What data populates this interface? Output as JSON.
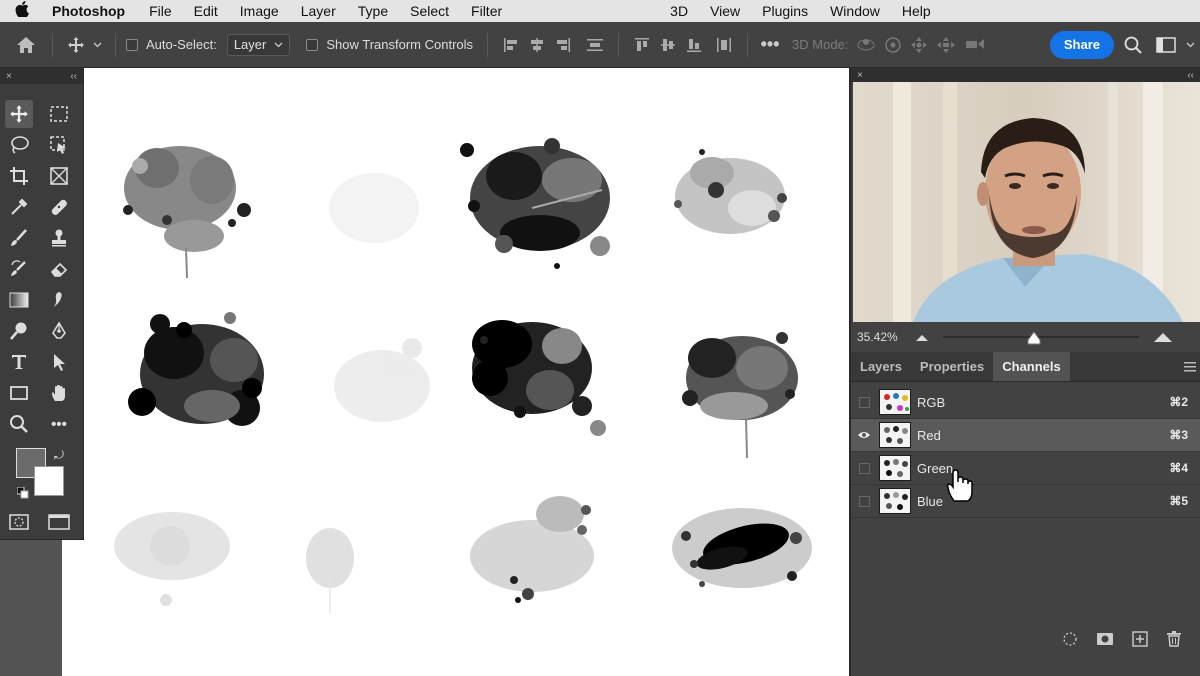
{
  "menubar": {
    "app_name": "Photoshop",
    "items_left": [
      "File",
      "Edit",
      "Image",
      "Layer",
      "Type",
      "Select",
      "Filter"
    ],
    "items_right": [
      "3D",
      "View",
      "Plugins",
      "Window",
      "Help"
    ]
  },
  "options": {
    "auto_select_label": "Auto-Select:",
    "auto_select_value": "Layer",
    "transform_label": "Show Transform Controls",
    "mode_3d_label": "3D Mode:",
    "share_label": "Share"
  },
  "navigator": {
    "zoom": "35.42%",
    "zoom_slider_fraction": 0.46
  },
  "panel": {
    "tabs": [
      "Layers",
      "Properties",
      "Channels"
    ],
    "active_tab": "Channels",
    "channels": [
      {
        "name": "RGB",
        "shortcut": "⌘2",
        "visible": false,
        "selected": false
      },
      {
        "name": "Red",
        "shortcut": "⌘3",
        "visible": true,
        "selected": true
      },
      {
        "name": "Green",
        "shortcut": "⌘4",
        "visible": false,
        "selected": false
      },
      {
        "name": "Blue",
        "shortcut": "⌘5",
        "visible": false,
        "selected": false
      }
    ]
  },
  "colors": {
    "accent": "#1473e6",
    "panel": "#424242",
    "selected_row": "#5a5a5a"
  }
}
